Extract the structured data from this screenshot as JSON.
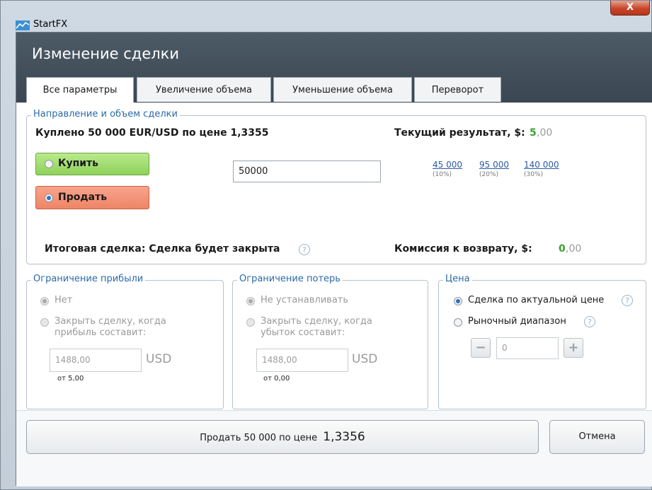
{
  "window": {
    "title": "StartFX",
    "close_label": "X"
  },
  "header": {
    "title": "Изменение сделки"
  },
  "tabs": [
    {
      "label": "Все параметры",
      "active": true
    },
    {
      "label": "Увеличение объема",
      "active": false
    },
    {
      "label": "Уменьшение объема",
      "active": false
    },
    {
      "label": "Переворот",
      "active": false
    }
  ],
  "direction": {
    "legend": "Направление и объем сделки",
    "bought_text": "Куплено 50 000 EUR/USD по цене 1,3355",
    "result_label": "Текущий результат, $:",
    "result_int": "5",
    "result_dec": ",00",
    "buy_label": "Купить",
    "sell_label": "Продать",
    "selected": "sell",
    "volume_value": "50000",
    "quick_volumes": [
      {
        "value": "45 000",
        "pct": "(10%)"
      },
      {
        "value": "95 000",
        "pct": "(20%)"
      },
      {
        "value": "140 000",
        "pct": "(30%)"
      }
    ],
    "final_label": "Итоговая сделка: Сделка будет закрыта",
    "commission_label": "Комиссия к возврату, $:",
    "commission_int": "0",
    "commission_dec": ",00",
    "help_glyph": "?"
  },
  "profit": {
    "legend": "Ограничение прибыли",
    "option_none": "Нет",
    "option_close_line1": "Закрыть сделку, когда",
    "option_close_line2": "прибыль составит:",
    "value": "1488,00",
    "currency": "USD",
    "min_note": "от 5,00"
  },
  "loss": {
    "legend": "Ограничение потерь",
    "option_none": "Не устанавливать",
    "option_close_line1": "Закрыть сделку, когда",
    "option_close_line2": "убыток составит:",
    "value": "1488,00",
    "currency": "USD",
    "min_note": "от 0,00"
  },
  "price": {
    "legend": "Цена",
    "option_current": "Сделка по актуальной цене",
    "option_range": "Рыночный диапазон",
    "range_value": "0",
    "minus": "−",
    "plus": "+"
  },
  "actions": {
    "submit_prefix": "Продать 50 000 по цене",
    "submit_price": "1,3356",
    "cancel": "Отмена"
  },
  "colors": {
    "accent": "#2b6aa8",
    "green": "#3aa12e",
    "header_bg": "#414e5a"
  }
}
